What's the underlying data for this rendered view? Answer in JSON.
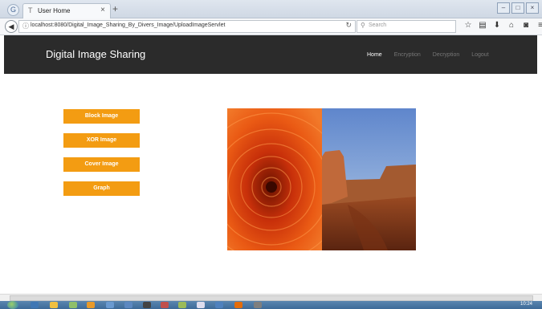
{
  "browser": {
    "tab_title": "User Home",
    "tab_close": "×",
    "new_tab": "+",
    "url": "localhost:8080/Digital_Image_Sharing_By_Divers_Image/UploadImageServlet",
    "search_placeholder": "Search"
  },
  "site": {
    "brand": "Digital Image Sharing",
    "nav": [
      "Home",
      "Encryption",
      "Decryption",
      "Logout"
    ],
    "active_nav": "Home"
  },
  "actions": [
    "Block Image",
    "XOR Image",
    "Cover Image",
    "Graph"
  ],
  "colors": {
    "header_bg": "#2b2b2b",
    "button_bg": "#f39c12"
  },
  "image": {
    "description_icons": [
      "flower-photo",
      "desert-canyon-photo"
    ]
  },
  "taskbar": {
    "clock": "10:24"
  }
}
